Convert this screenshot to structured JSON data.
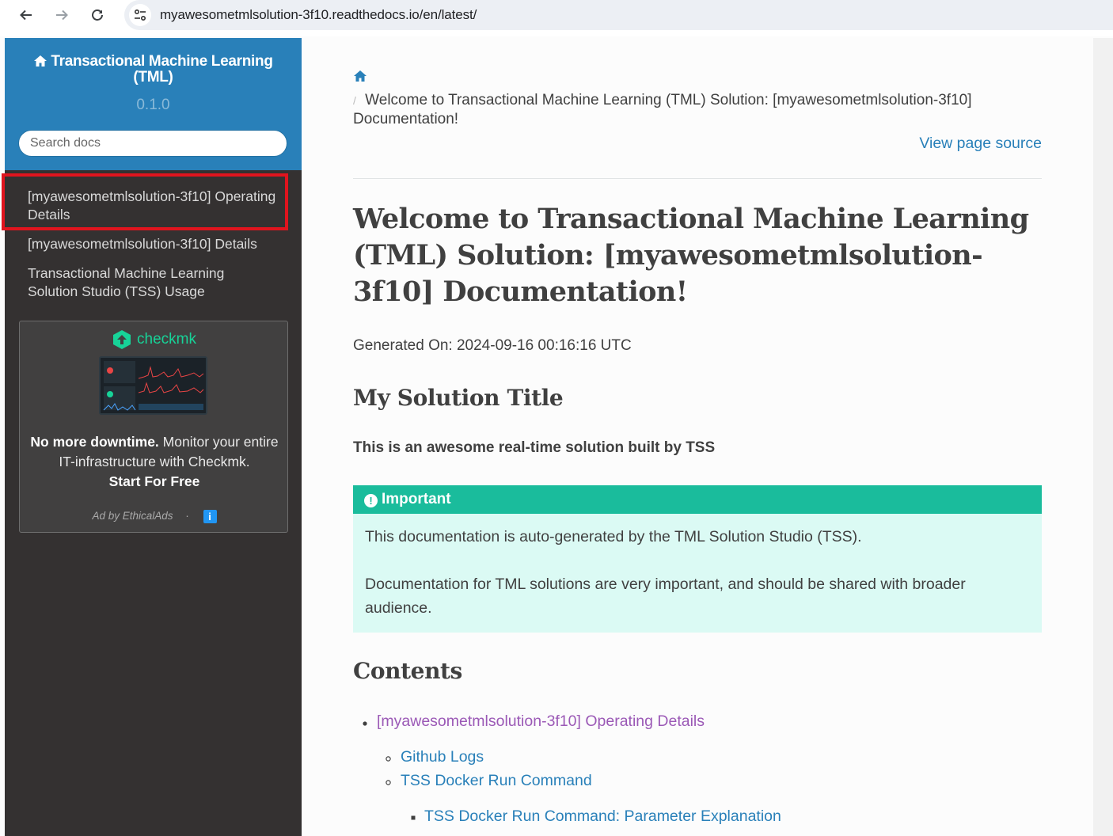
{
  "browser": {
    "url": "myawesometmlsolution-3f10.readthedocs.io/en/latest/"
  },
  "sidebar": {
    "project_title": "Transactional Machine Learning (TML)",
    "version": "0.1.0",
    "search_placeholder": "Search docs",
    "nav_items": [
      {
        "label": "[myawesometmlsolution-3f10] Operating Details"
      },
      {
        "label": "[myawesometmlsolution-3f10] Details"
      },
      {
        "label": "Transactional Machine Learning Solution Studio (TSS) Usage"
      }
    ],
    "ad": {
      "brand": "checkmk",
      "headline": "No more downtime.",
      "body": "Monitor your entire IT-infrastructure with Checkmk.",
      "cta": "Start For Free",
      "attribution": "Ad by EthicalAds",
      "separator": "·",
      "info": "i"
    }
  },
  "main": {
    "breadcrumb_sep": "/",
    "breadcrumb_current": "Welcome to Transactional Machine Learning (TML) Solution: [myawesometmlsolution-3f10] Documentation!",
    "view_source": "View page source",
    "title": "Welcome to Transactional Machine Learning (TML) Solution: [myawesometmlsolution-3f10] Documentation!",
    "generated": "Generated On: 2024-09-16 00:16:16 UTC",
    "section_title": "My Solution Title",
    "subtitle": "This is an awesome real-time solution built by TSS",
    "admonition": {
      "title": "Important",
      "p1": "This documentation is auto-generated by the TML Solution Studio (TSS).",
      "p2": "Documentation for TML solutions are very important, and should be shared with broader audience."
    },
    "contents_title": "Contents",
    "toc": [
      {
        "label": "[myawesometmlsolution-3f10] Operating Details"
      },
      {
        "label": "Github Logs"
      },
      {
        "label": "TSS Docker Run Command"
      },
      {
        "label": "TSS Docker Run Command: Parameter Explanation"
      }
    ]
  },
  "colors": {
    "sidebar_bg": "#343131",
    "header_blue": "#2980b9",
    "link": "#2980b9",
    "visited_link": "#9b59b6",
    "admonition_title": "#1abc9c",
    "admonition_bg": "#dbfaf4",
    "highlight_box": "#e0141e"
  }
}
